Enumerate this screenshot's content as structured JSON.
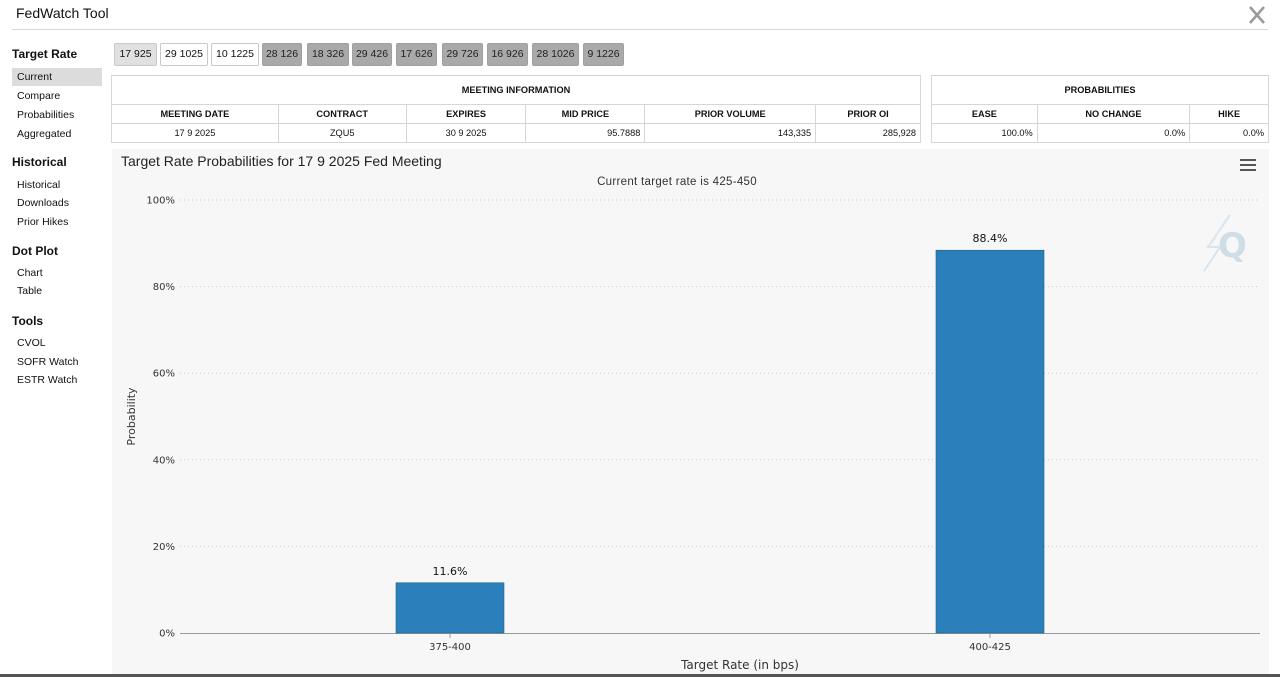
{
  "app": {
    "title": "FedWatch Tool"
  },
  "sidebar": {
    "sections": [
      {
        "title": "Target Rate",
        "items": [
          "Current",
          "Compare",
          "Probabilities",
          "Aggregated"
        ]
      },
      {
        "title": "Historical",
        "items": [
          "Historical",
          "Downloads",
          "Prior Hikes"
        ]
      },
      {
        "title": "Dot Plot",
        "items": [
          "Chart",
          "Table"
        ]
      },
      {
        "title": "Tools",
        "items": [
          "CVOL",
          "SOFR Watch",
          "ESTR Watch"
        ]
      }
    ],
    "active_item": "Current"
  },
  "meeting_tabs": [
    "17 925",
    "29 1025",
    "10 1225",
    "28 126",
    "18 326",
    "29 426",
    "17 626",
    "29 726",
    "16 926",
    "28 1026",
    "9 1226"
  ],
  "meeting_info": {
    "group_label": "MEETING INFORMATION",
    "columns": [
      "MEETING DATE",
      "CONTRACT",
      "EXPIRES",
      "MID PRICE",
      "PRIOR VOLUME",
      "PRIOR OI"
    ],
    "row": [
      "17 9 2025",
      "ZQU5",
      "30 9 2025",
      "95.7888",
      "143,335",
      "285,928"
    ]
  },
  "probabilities": {
    "group_label": "PROBABILITIES",
    "columns": [
      "EASE",
      "NO CHANGE",
      "HIKE"
    ],
    "row": [
      "100.0%",
      "0.0%",
      "0.0%"
    ]
  },
  "chart_data": {
    "type": "bar",
    "title": "Target Rate Probabilities for 17 9 2025 Fed Meeting",
    "subtitle": "Current target rate is 425-450",
    "xlabel": "Target Rate (in bps)",
    "ylabel": "Probability",
    "categories": [
      "375-400",
      "400-425"
    ],
    "values": [
      11.6,
      88.4
    ],
    "data_labels": [
      "11.6%",
      "88.4%"
    ],
    "ylim": [
      0,
      100
    ],
    "yticks": [
      0,
      20,
      40,
      60,
      80,
      100
    ],
    "ytick_labels": [
      "0%",
      "20%",
      "40%",
      "60%",
      "80%",
      "100%"
    ],
    "bar_color": "#2b7fba",
    "grid": true
  },
  "colors": {
    "bar": "#2b7fba",
    "tab_dark": "#a9a9a9"
  },
  "icons": {
    "close": "close-x-icon",
    "menu": "hamburger-menu-icon",
    "logo": "quikstrike-q-logo"
  }
}
